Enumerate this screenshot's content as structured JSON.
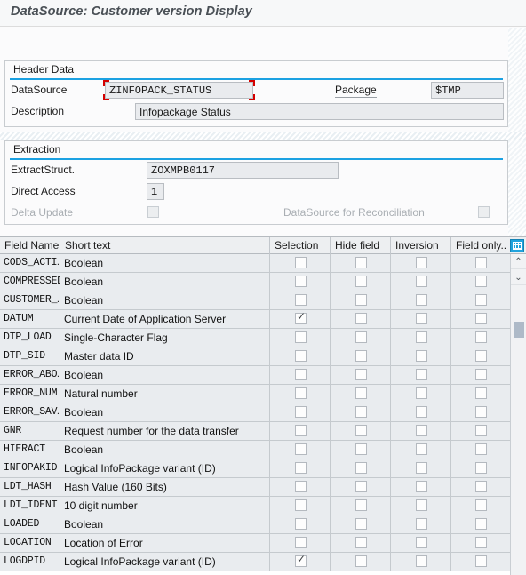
{
  "window": {
    "title": "DataSource: Customer version Display"
  },
  "header_section": {
    "legend": "Header Data",
    "datasource": {
      "label": "DataSource",
      "value": "ZINFOPACK_STATUS",
      "focused": true
    },
    "package": {
      "label": "Package",
      "value": "$TMP"
    },
    "description": {
      "label": "Description",
      "value": "Infopackage Status"
    }
  },
  "extraction_section": {
    "legend": "Extraction",
    "extract_struct": {
      "label": "ExtractStruct.",
      "value": "ZOXMPB0117"
    },
    "direct_access": {
      "label": "Direct Access",
      "value": "1"
    },
    "delta_update": {
      "label": "Delta Update",
      "checked": false,
      "disabled": true
    },
    "reconciliation": {
      "label": "DataSource for Reconciliation",
      "checked": false,
      "disabled": true
    }
  },
  "field_table": {
    "columns": [
      "Field Name",
      "Short text",
      "Selection",
      "Hide field",
      "Inversion",
      "Field only.."
    ],
    "settings_icon": "table-settings-icon",
    "rows": [
      {
        "field": "CODS_ACTI…",
        "short_text": "Boolean",
        "selection": false,
        "hide_field": false,
        "inversion": false,
        "field_only": false
      },
      {
        "field": "COMPRESSED",
        "short_text": "Boolean",
        "selection": false,
        "hide_field": false,
        "inversion": false,
        "field_only": false
      },
      {
        "field": "CUSTOMER_…",
        "short_text": "Boolean",
        "selection": false,
        "hide_field": false,
        "inversion": false,
        "field_only": false
      },
      {
        "field": "DATUM",
        "short_text": "Current Date of Application Server",
        "selection": true,
        "hide_field": false,
        "inversion": false,
        "field_only": false
      },
      {
        "field": "DTP_LOAD",
        "short_text": "Single-Character Flag",
        "selection": false,
        "hide_field": false,
        "inversion": false,
        "field_only": false
      },
      {
        "field": "DTP_SID",
        "short_text": "Master data ID",
        "selection": false,
        "hide_field": false,
        "inversion": false,
        "field_only": false
      },
      {
        "field": "ERROR_ABO…",
        "short_text": "Boolean",
        "selection": false,
        "hide_field": false,
        "inversion": false,
        "field_only": false
      },
      {
        "field": "ERROR_NUM",
        "short_text": "Natural number",
        "selection": false,
        "hide_field": false,
        "inversion": false,
        "field_only": false
      },
      {
        "field": "ERROR_SAV…",
        "short_text": "Boolean",
        "selection": false,
        "hide_field": false,
        "inversion": false,
        "field_only": false
      },
      {
        "field": "GNR",
        "short_text": "Request number for the data transfer",
        "selection": false,
        "hide_field": false,
        "inversion": false,
        "field_only": false
      },
      {
        "field": "HIERACT",
        "short_text": "Boolean",
        "selection": false,
        "hide_field": false,
        "inversion": false,
        "field_only": false
      },
      {
        "field": "INFOPAKID",
        "short_text": "Logical InfoPackage variant (ID)",
        "selection": false,
        "hide_field": false,
        "inversion": false,
        "field_only": false
      },
      {
        "field": "LDT_HASH",
        "short_text": "Hash Value (160 Bits)",
        "selection": false,
        "hide_field": false,
        "inversion": false,
        "field_only": false
      },
      {
        "field": "LDT_IDENT",
        "short_text": "10 digit number",
        "selection": false,
        "hide_field": false,
        "inversion": false,
        "field_only": false
      },
      {
        "field": "LOADED",
        "short_text": "Boolean",
        "selection": false,
        "hide_field": false,
        "inversion": false,
        "field_only": false
      },
      {
        "field": "LOCATION",
        "short_text": "Location of Error",
        "selection": false,
        "hide_field": false,
        "inversion": false,
        "field_only": false
      },
      {
        "field": "LOGDPID",
        "short_text": "Logical InfoPackage variant (ID)",
        "selection": true,
        "hide_field": false,
        "inversion": false,
        "field_only": false
      }
    ],
    "scrollbar": {
      "up_arrow": "⌃",
      "down_arrow": "⌄"
    }
  },
  "colors": {
    "accent_blue": "#1ba1e2",
    "focus_red": "#d40000",
    "row_bg": "#e9ecef",
    "header_bg": "#edeff1"
  }
}
